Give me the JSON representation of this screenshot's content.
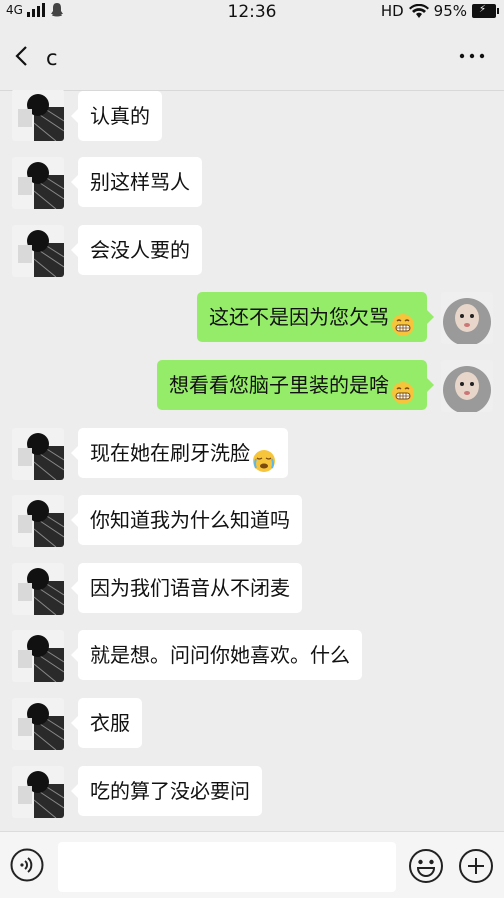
{
  "status_bar": {
    "network": "4G",
    "time": "12:36",
    "hd": "HD",
    "battery_percent": "95%",
    "icons": [
      "signal-icon",
      "notification-icon",
      "wifi-icon",
      "battery-icon"
    ]
  },
  "chat": {
    "title": "c",
    "icons": {
      "back": "back-icon",
      "more": "more-icon"
    }
  },
  "messages": [
    {
      "side": "left",
      "text": "认真的",
      "emoji": ""
    },
    {
      "side": "left",
      "text": "别这样骂人",
      "emoji": ""
    },
    {
      "side": "left",
      "text": "会没人要的",
      "emoji": ""
    },
    {
      "side": "right",
      "text": "这还不是因为您欠骂",
      "emoji": "grin"
    },
    {
      "side": "right",
      "text": "想看看您脑子里装的是啥",
      "emoji": "grin"
    },
    {
      "side": "left",
      "text": "现在她在刷牙洗脸",
      "emoji": "cry"
    },
    {
      "side": "left",
      "text": "你知道我为什么知道吗",
      "emoji": ""
    },
    {
      "side": "left",
      "text": "因为我们语音从不闭麦",
      "emoji": ""
    },
    {
      "side": "left",
      "text": "就是想。问问你她喜欢。什么",
      "emoji": ""
    },
    {
      "side": "left",
      "text": "衣服",
      "emoji": ""
    },
    {
      "side": "left",
      "text": "吃的算了没必要问",
      "emoji": ""
    }
  ],
  "input_bar": {
    "placeholder": "",
    "icons": {
      "voice": "voice-icon",
      "sticker": "smile-icon",
      "plus": "plus-icon"
    }
  },
  "colors": {
    "background": "#ededed",
    "sent_bubble": "#95ec69",
    "received_bubble": "#ffffff"
  }
}
